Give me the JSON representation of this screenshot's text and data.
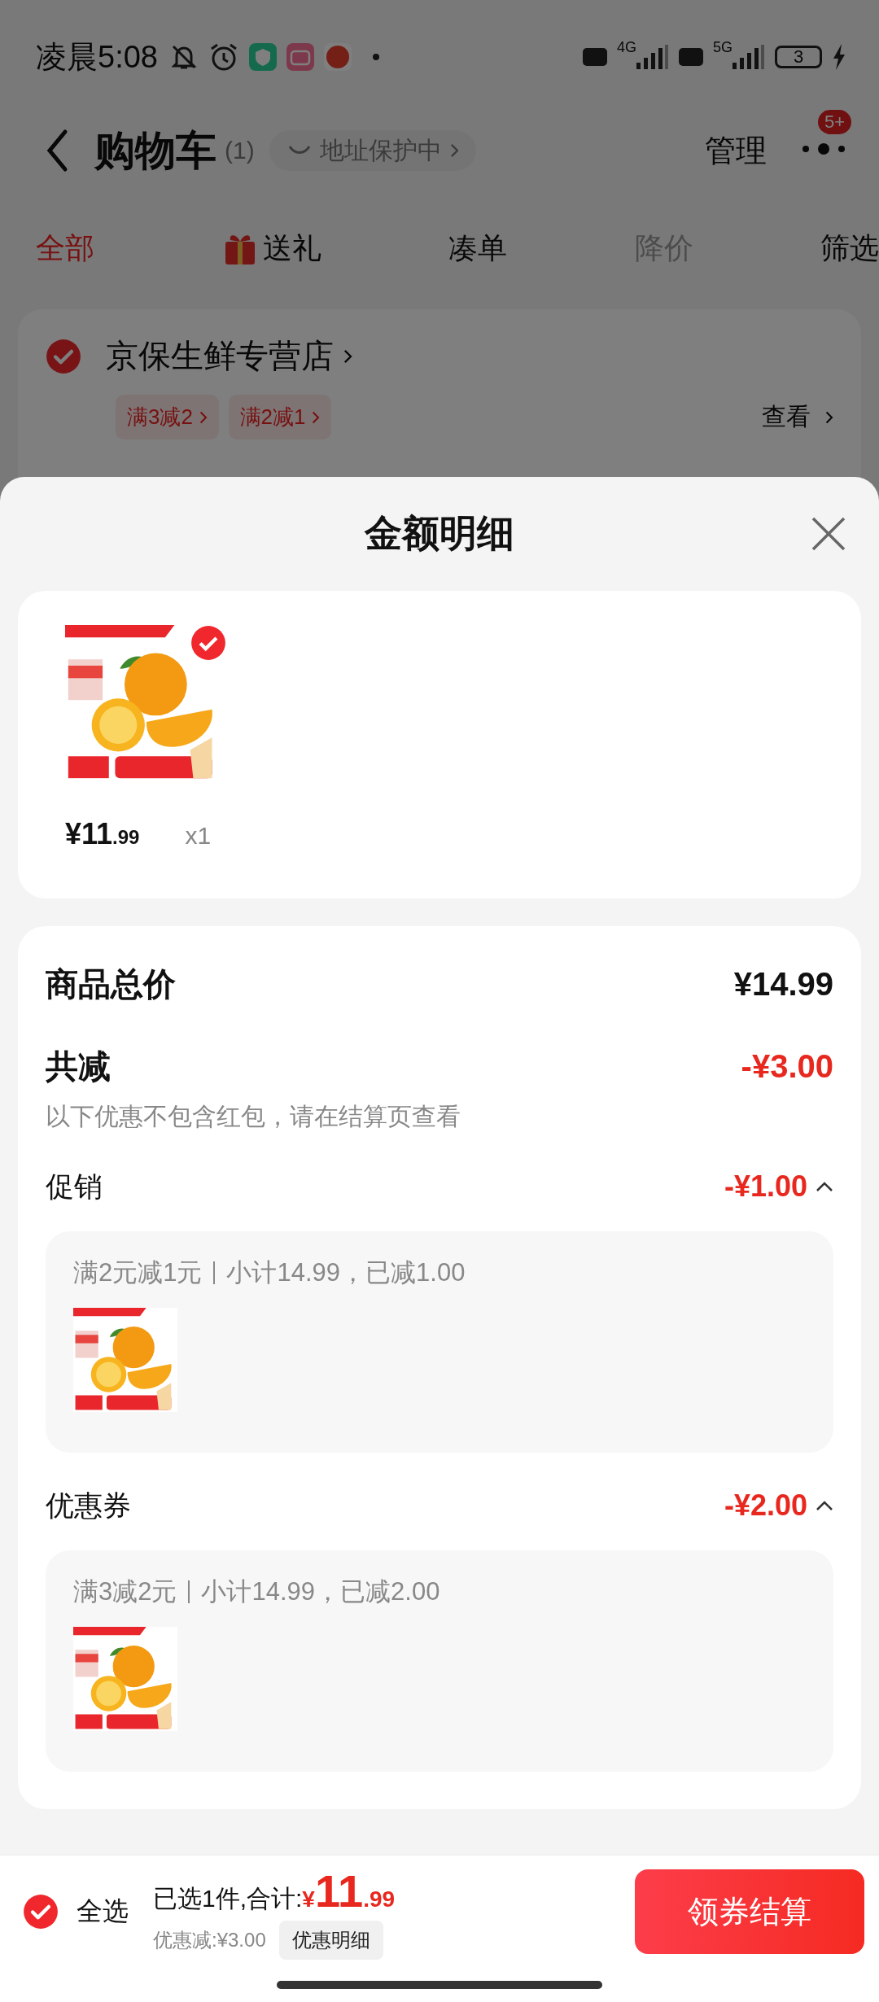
{
  "status_bar": {
    "time": "凌晨5:08",
    "network_1": "4G",
    "network_2": "5G",
    "battery": "3"
  },
  "header": {
    "title": "购物车",
    "count": "(1)",
    "address_chip": "地址保护中",
    "manage": "管理",
    "badge": "5+"
  },
  "tabs": [
    {
      "label": "全部",
      "selected": true,
      "disabled": false,
      "kind": "text"
    },
    {
      "label": "送礼",
      "selected": false,
      "disabled": false,
      "kind": "gift"
    },
    {
      "label": "凑单",
      "selected": false,
      "disabled": false,
      "kind": "text"
    },
    {
      "label": "降价",
      "selected": false,
      "disabled": true,
      "kind": "text"
    },
    {
      "label": "筛选",
      "selected": false,
      "disabled": false,
      "kind": "text"
    }
  ],
  "store": {
    "name": "京保生鲜专营店",
    "checked": true,
    "tags": [
      "满3减2",
      "满2减1"
    ],
    "view": "查看"
  },
  "sheet": {
    "title": "金额明细",
    "items": [
      {
        "kind": "picture",
        "checked": true,
        "price_main": "¥11",
        "price_cents": ".99",
        "qty": "x1"
      }
    ],
    "total_label": "商品总价",
    "total": "¥14.99",
    "discount_label": "共减",
    "discount": "-¥3.00",
    "note": "以下优惠不包含红包，请在结算页查看",
    "groups": [
      {
        "label": "促销",
        "amount": "-¥1.00",
        "expanded": true,
        "rule": "满2元减1元",
        "detail": "小计14.99，已减1.00"
      },
      {
        "label": "优惠券",
        "amount": "-¥2.00",
        "expanded": true,
        "rule": "满3减2元",
        "detail": "小计14.99，已减2.00"
      }
    ]
  },
  "bottom_bar": {
    "select_all": "全选",
    "checked": true,
    "selected_text": "已选1件,合计:",
    "currency": "¥",
    "total_main": "11",
    "total_cents": ".99",
    "saved": "优惠减:¥3.00",
    "detail_button": "优惠明细",
    "checkout": "领券结算"
  }
}
